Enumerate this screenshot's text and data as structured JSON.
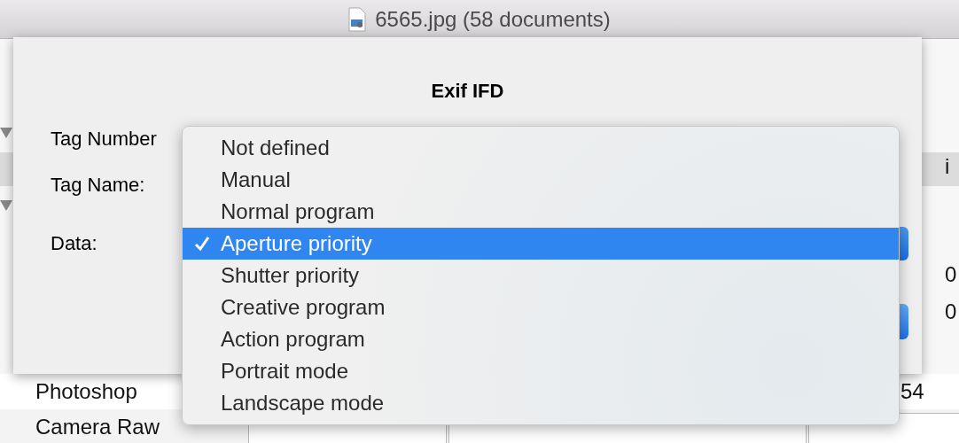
{
  "window": {
    "title": "6565.jpg (58 documents)"
  },
  "background_list": [
    {
      "label": "Photoshop",
      "value": "54"
    },
    {
      "label": "Camera Raw"
    }
  ],
  "right_column": [
    "i",
    "0",
    "0"
  ],
  "dialog": {
    "title": "Exif IFD",
    "labels": [
      "Tag Number",
      "Tag Name:",
      "Data:"
    ]
  },
  "menu": {
    "items": [
      {
        "label": "Not defined",
        "selected": false
      },
      {
        "label": "Manual",
        "selected": false
      },
      {
        "label": "Normal program",
        "selected": false
      },
      {
        "label": "Aperture priority",
        "selected": true
      },
      {
        "label": "Shutter priority",
        "selected": false
      },
      {
        "label": "Creative program",
        "selected": false
      },
      {
        "label": "Action program",
        "selected": false
      },
      {
        "label": "Portrait mode",
        "selected": false
      },
      {
        "label": "Landscape mode",
        "selected": false
      }
    ]
  }
}
